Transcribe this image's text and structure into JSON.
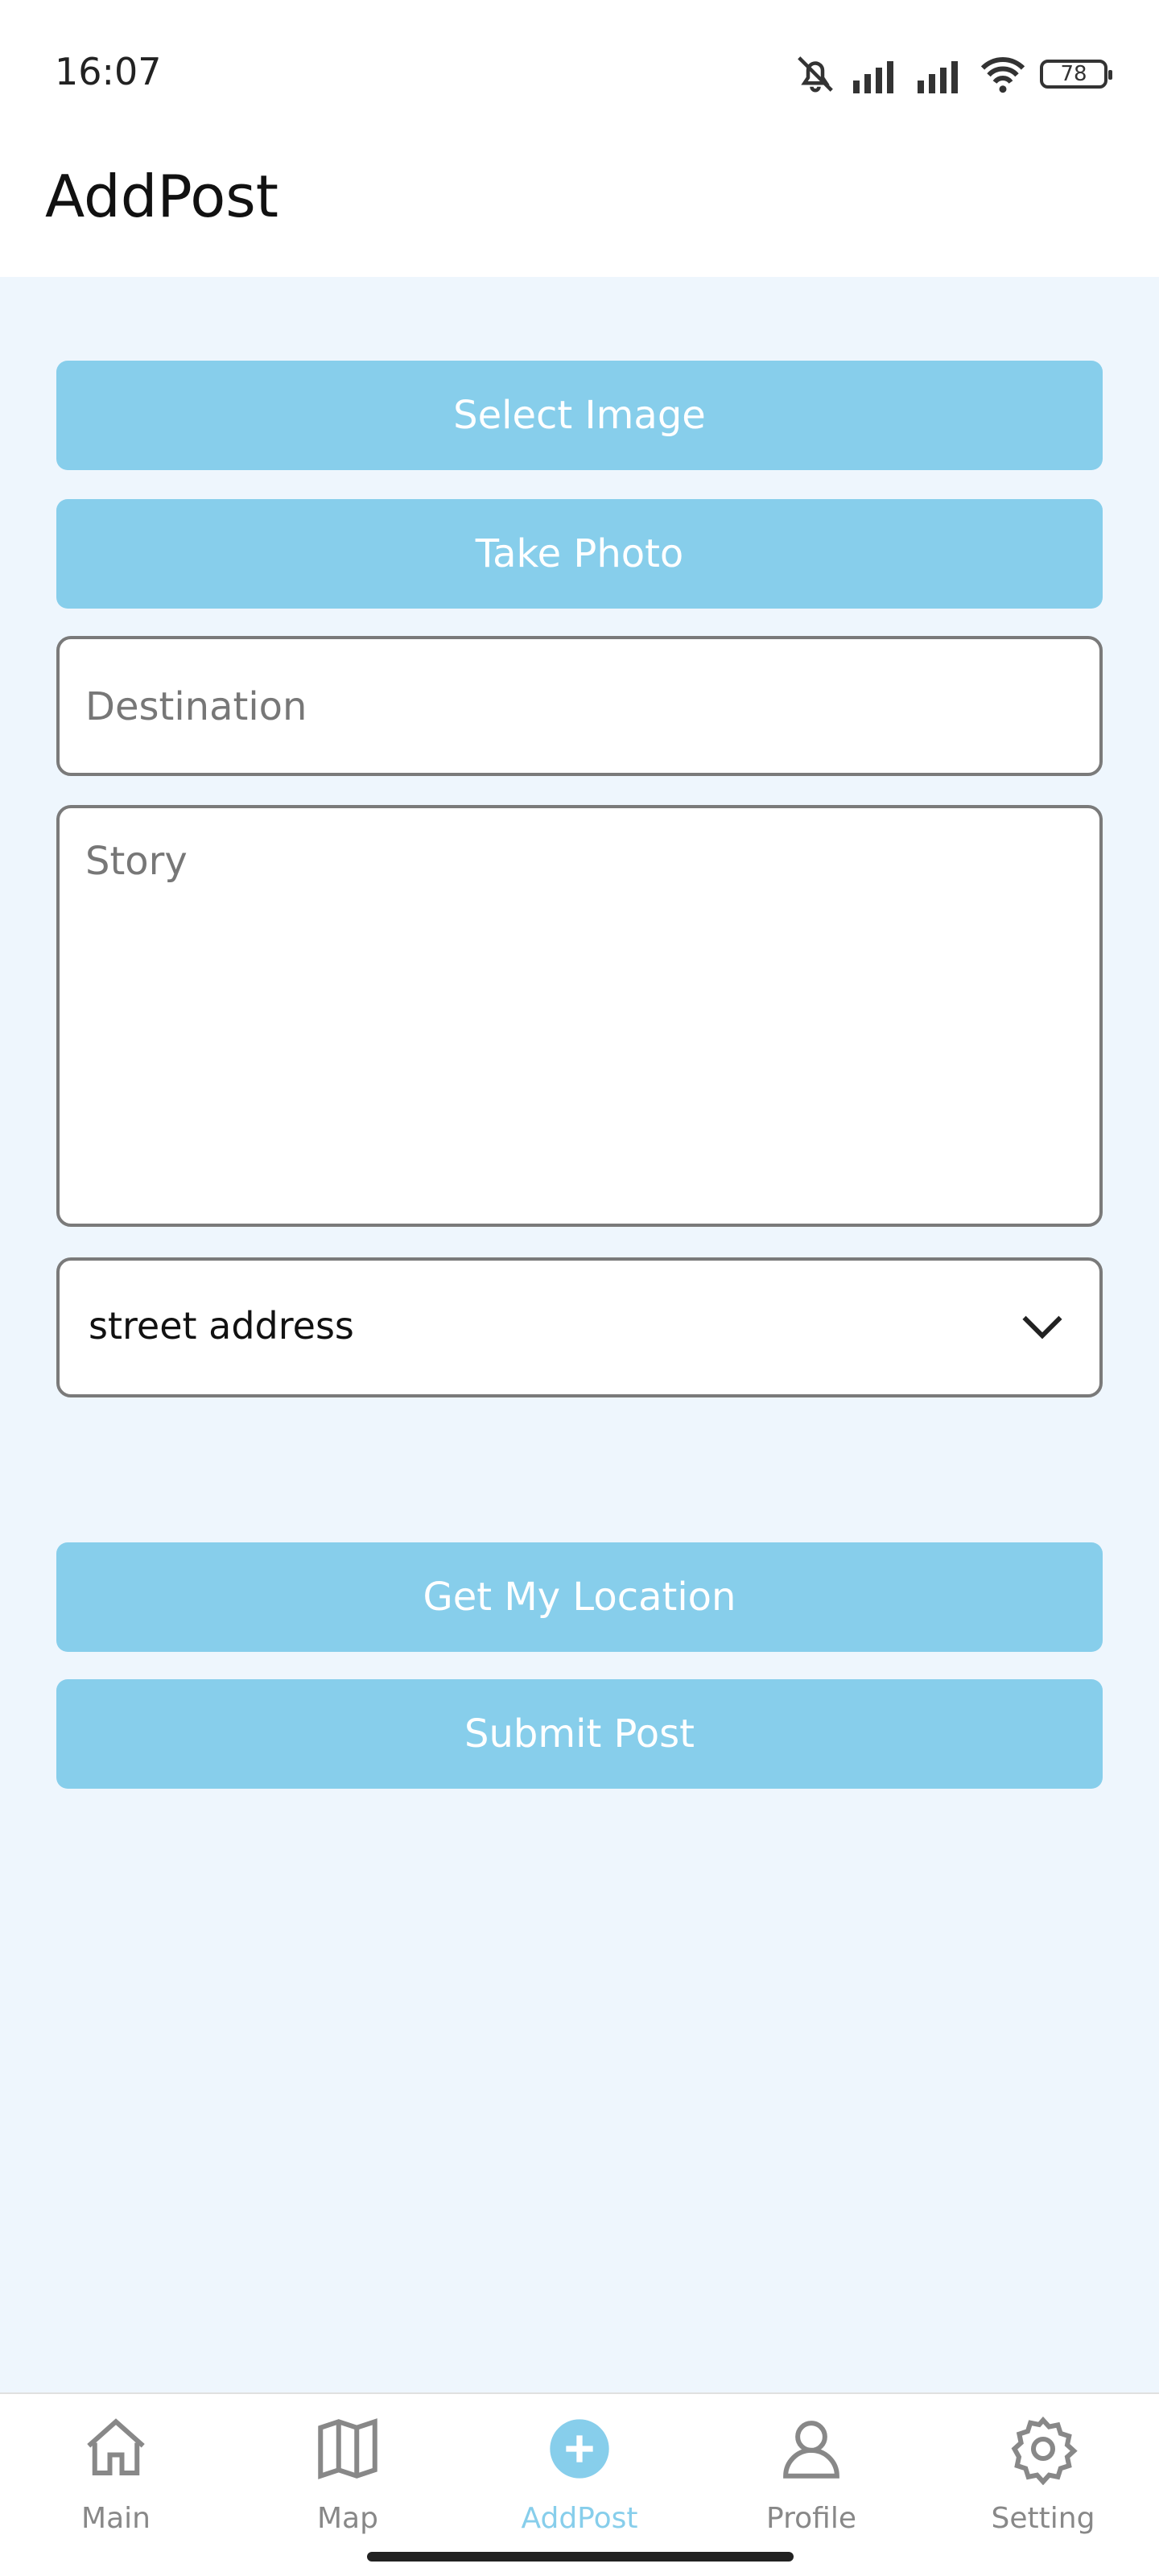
{
  "status": {
    "time": "16:07",
    "battery": "78"
  },
  "header": {
    "title": "AddPost"
  },
  "form": {
    "select_image_label": "Select Image",
    "take_photo_label": "Take Photo",
    "destination_placeholder": "Destination",
    "story_placeholder": "Story",
    "address_select_value": "street address",
    "get_location_label": "Get My Location",
    "submit_label": "Submit Post"
  },
  "tabs": [
    {
      "label": "Main",
      "icon": "home-icon"
    },
    {
      "label": "Map",
      "icon": "map-icon"
    },
    {
      "label": "AddPost",
      "icon": "add-post-icon",
      "active": true
    },
    {
      "label": "Profile",
      "icon": "profile-icon"
    },
    {
      "label": "Setting",
      "icon": "gear-icon"
    }
  ],
  "colors": {
    "accent": "#87CEEB",
    "background": "#EEF6FD"
  }
}
